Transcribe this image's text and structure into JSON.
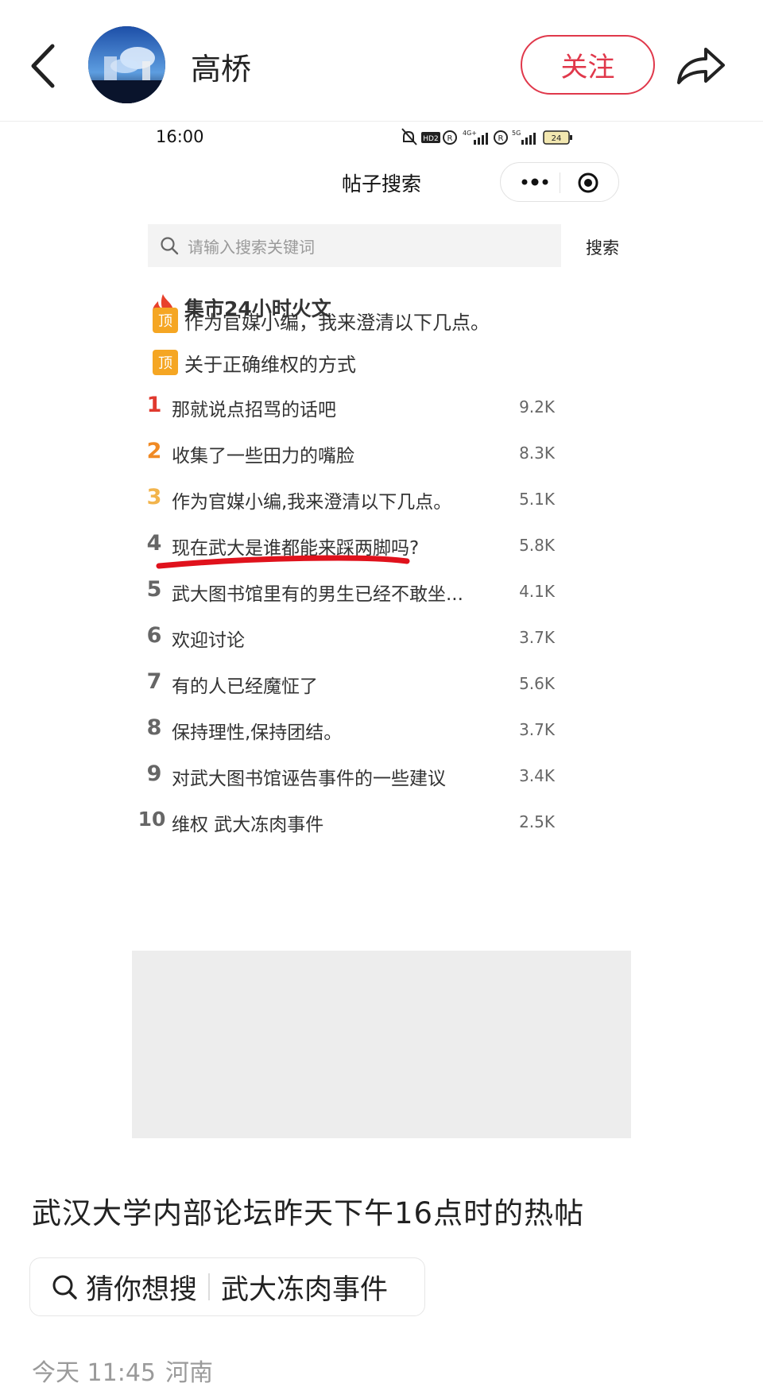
{
  "header": {
    "username": "高桥",
    "follow_label": "关注"
  },
  "screenshot": {
    "status_time": "16:00",
    "battery": "24",
    "status_labels": [
      "HD2",
      "4G+",
      "5G"
    ],
    "mini_title": "帖子搜索",
    "search_placeholder": "请输入搜索关键词",
    "search_button": "搜索",
    "hot_title": "集市24小时火文",
    "pinned": [
      {
        "badge": "顶",
        "title": "作为官媒小编，我来澄清以下几点。"
      },
      {
        "badge": "顶",
        "title": "关于正确维权的方式"
      }
    ],
    "ranking": [
      {
        "rank": "1",
        "title": "那就说点招骂的话吧",
        "count": "9.2K",
        "color": "#e03a2f"
      },
      {
        "rank": "2",
        "title": "收集了一些田力的嘴脸",
        "count": "8.3K",
        "color": "#f08a24"
      },
      {
        "rank": "3",
        "title": "作为官媒小编,我来澄清以下几点。",
        "count": "5.1K",
        "color": "#f2b44c"
      },
      {
        "rank": "4",
        "title": "现在武大是谁都能来踩两脚吗?",
        "count": "5.8K",
        "color": "#666666"
      },
      {
        "rank": "5",
        "title": "武大图书馆里有的男生已经不敢坐...",
        "count": "4.1K",
        "color": "#666666"
      },
      {
        "rank": "6",
        "title": "欢迎讨论",
        "count": "3.7K",
        "color": "#666666"
      },
      {
        "rank": "7",
        "title": "有的人已经魔怔了",
        "count": "5.6K",
        "color": "#666666"
      },
      {
        "rank": "8",
        "title": "保持理性,保持团结。",
        "count": "3.7K",
        "color": "#666666"
      },
      {
        "rank": "9",
        "title": "对武大图书馆诬告事件的一些建议",
        "count": "3.4K",
        "color": "#666666"
      },
      {
        "rank": "10",
        "title": "维权 武大冻肉事件",
        "count": "2.5K",
        "color": "#666666"
      }
    ]
  },
  "post": {
    "caption": "武汉大学内部论坛昨天下午16点时的热帖",
    "hint_label": "猜你想搜",
    "hint_keyword": "武大冻肉事件",
    "date": "今天 11:45",
    "location": "河南"
  },
  "colors": {
    "accent_red": "#e0384b",
    "pin_orange": "#f5a623",
    "underline_red": "#e0121c"
  }
}
